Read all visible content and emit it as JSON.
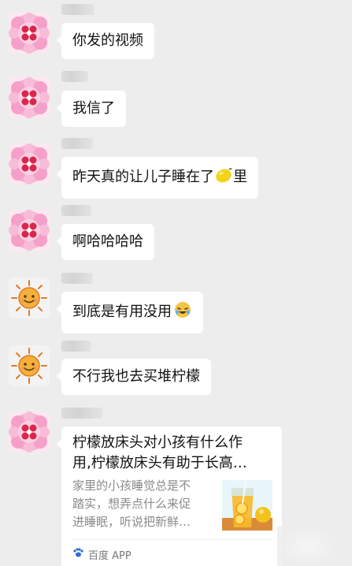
{
  "messages": [
    {
      "type": "text",
      "avatar": "flower-avatar",
      "text": "你发的视频"
    },
    {
      "type": "text",
      "avatar": "flower-avatar",
      "text": "我信了"
    },
    {
      "type": "text",
      "avatar": "flower-avatar",
      "text": "昨天真的让儿子睡在了",
      "emoji": "lemon",
      "suffix": "里"
    },
    {
      "type": "text",
      "avatar": "flower-avatar",
      "text": "啊哈哈哈哈"
    },
    {
      "type": "text",
      "avatar": "sun-avatar",
      "text": "到底是有用没用",
      "emoji": "rolling-on-floor-laughing"
    },
    {
      "type": "text",
      "avatar": "sun-avatar",
      "text": "不行我也去买堆柠檬"
    },
    {
      "type": "link-card",
      "avatar": "flower-avatar",
      "title_line1": "柠檬放床头对小孩有什么作",
      "title_line2": "用,柠檬放床头有助于长高…",
      "desc_line1": "家里的小孩睡觉总是不",
      "desc_line2": "踏实，想弄点什么来促",
      "desc_line3": "进睡眠，听说把新鲜…",
      "source": "百度 APP",
      "thumbnail": "lemon-drink-image",
      "source_icon": "baidu-paw-icon"
    }
  ],
  "colors": {
    "background": "#ededed",
    "bubble": "#ffffff",
    "flower_pink": "#f6a9cf",
    "flower_red": "#d9264a",
    "sun_orange": "#f2a632"
  }
}
